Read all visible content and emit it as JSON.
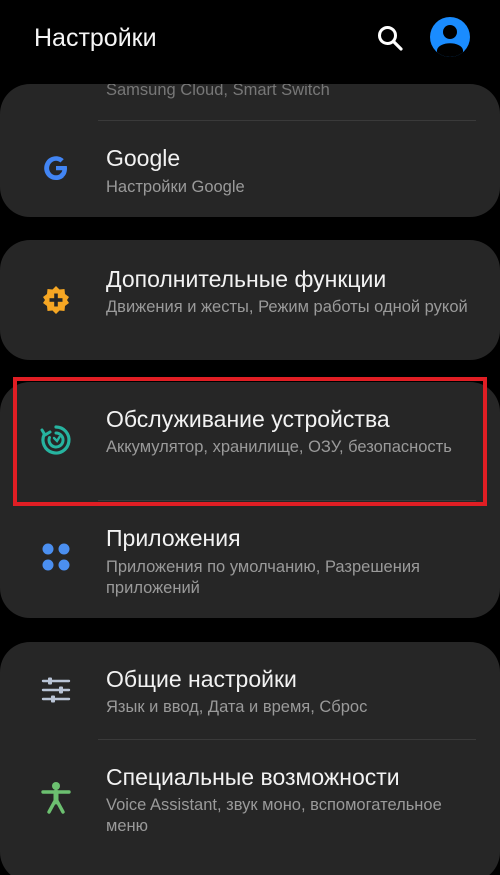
{
  "header": {
    "title": "Настройки",
    "search_icon": "search-icon",
    "avatar_icon": "account-avatar-icon",
    "accent": "#1a8cff"
  },
  "cards": [
    {
      "items": [
        {
          "subtitle": "Samsung Cloud, Smart Switch"
        },
        {
          "title": "Google",
          "subtitle": "Настройки Google",
          "icon": "google-icon",
          "color": "#4285f4"
        }
      ]
    },
    {
      "items": [
        {
          "title": "Дополнительные функции",
          "subtitle": "Движения и жесты, Режим работы одной рукой",
          "icon": "plus-gear-icon",
          "color": "#f5a623"
        }
      ]
    },
    {
      "items": [
        {
          "title": "Обслуживание устройства",
          "subtitle": "Аккумулятор, хранилище, ОЗУ, безопасность",
          "icon": "device-care-icon",
          "color": "#26b4a0"
        },
        {
          "title": "Приложения",
          "subtitle": "Приложения по умолчанию, Разрешения приложений",
          "icon": "apps-icon",
          "color": "#4b8ff0"
        }
      ]
    },
    {
      "items": [
        {
          "title": "Общие настройки",
          "subtitle": "Язык и ввод, Дата и время, Сброс",
          "icon": "sliders-icon",
          "color": "#b9c4d6"
        },
        {
          "title": "Специальные возможности",
          "subtitle": "Voice Assistant, звук моно, вспомогательное меню",
          "icon": "accessibility-icon",
          "color": "#6cc070"
        }
      ]
    }
  ],
  "highlight_color": "#e01e24"
}
